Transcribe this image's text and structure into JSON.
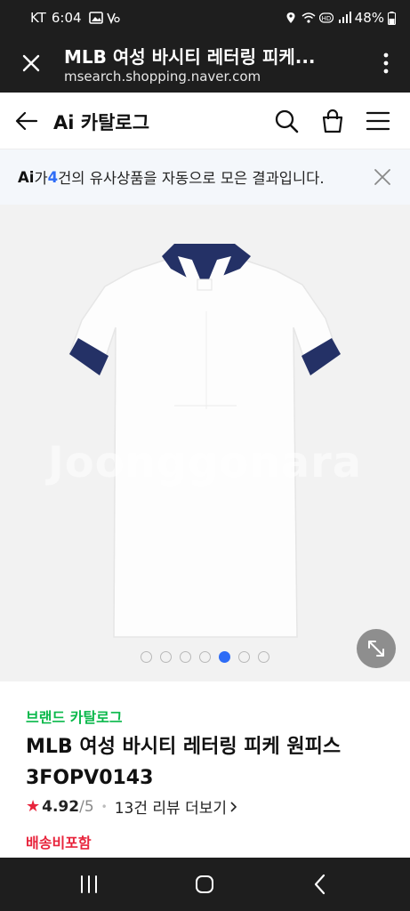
{
  "status_bar": {
    "carrier": "KT",
    "time": "6:04",
    "battery": "48%"
  },
  "browser": {
    "title": "MLB 여성 바시티 레터링 피케...",
    "url": "msearch.shopping.naver.com"
  },
  "header": {
    "title": "Ai 카탈로그"
  },
  "notice": {
    "ai_mark": "Ai",
    "prefix": "가 ",
    "count": "4",
    "suffix": "건의 유사상품을 자동으로 모은 결과입니다."
  },
  "gallery": {
    "watermark": "Joonggonara",
    "total_images": 7,
    "active_index": 5
  },
  "product": {
    "brand_link": "브랜드 카탈로그",
    "name": "MLB 여성 바시티 레터링 피케 원피스 3FOPV0143",
    "rating_score": "4.92",
    "rating_max": "/5",
    "review_text": "13건 리뷰 더보기",
    "shipping": "배송비포함"
  },
  "icons": {
    "close": "close-icon",
    "menu": "more-vert-icon",
    "back": "arrow-left-icon",
    "search": "search-icon",
    "cart": "shopping-bag-icon",
    "hamburger": "hamburger-menu-icon",
    "expand": "expand-icon",
    "recents": "recents-icon",
    "home": "home-icon",
    "nav_back": "nav-back-icon"
  },
  "colors": {
    "brand_green": "#09b84a",
    "accent_blue": "#2e6cf6",
    "rating_red": "#e8243c",
    "collar_navy": "#243166"
  }
}
